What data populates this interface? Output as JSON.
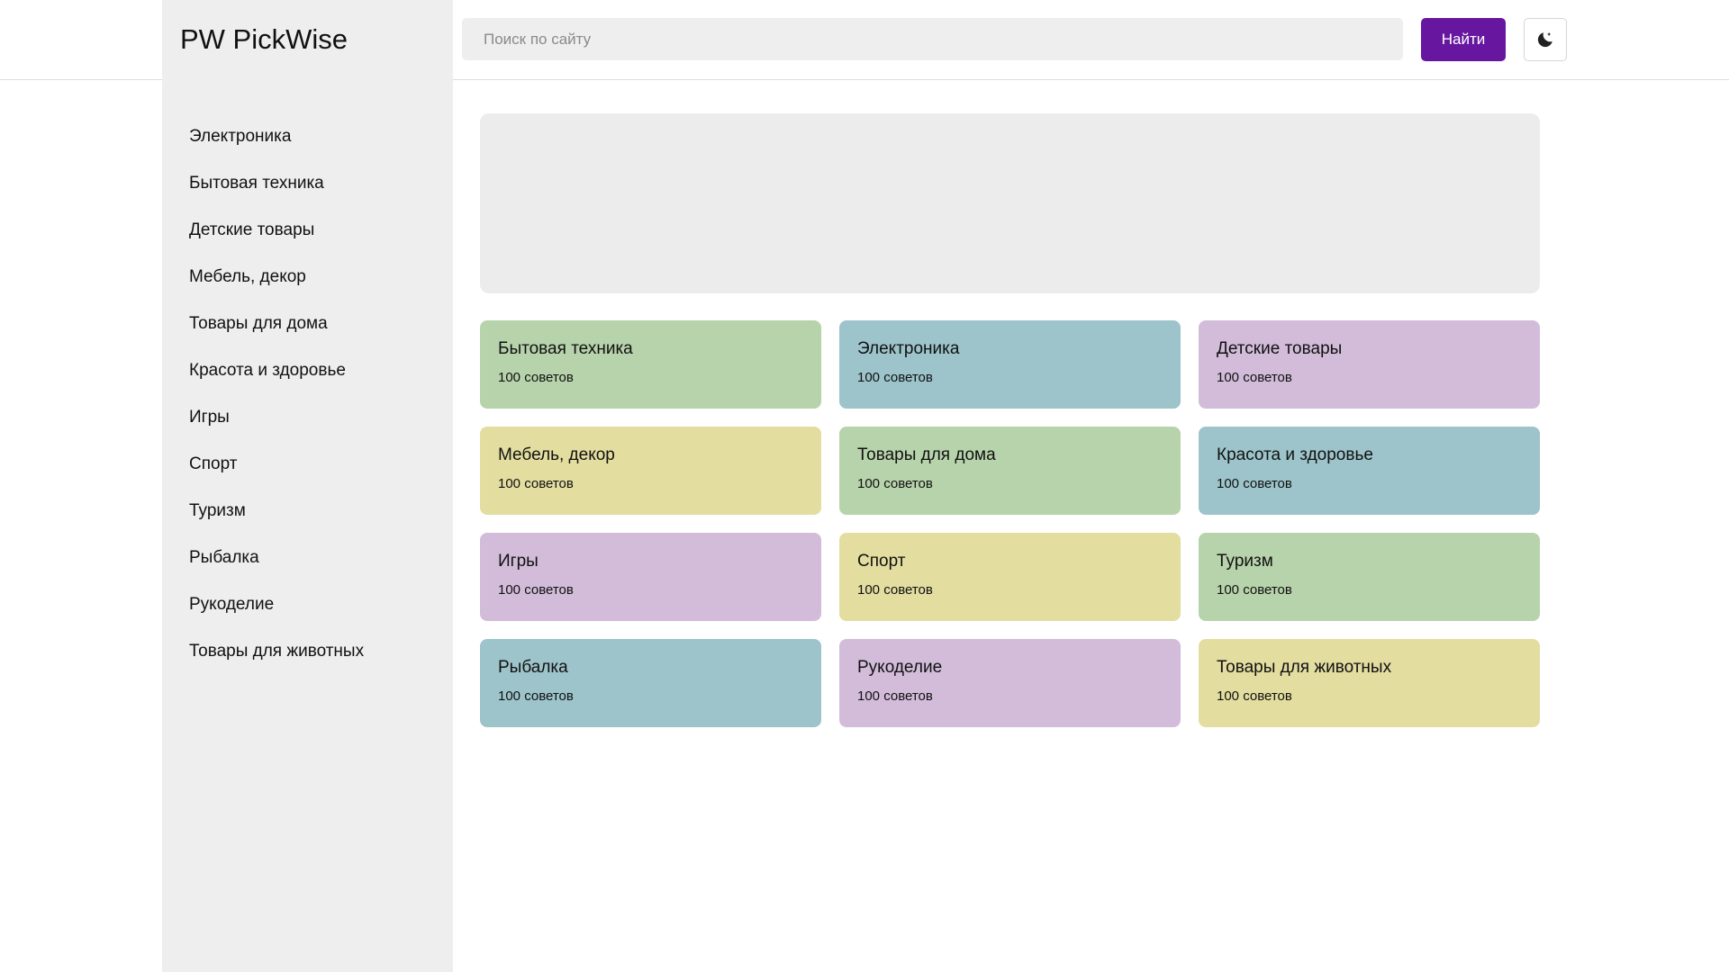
{
  "header": {
    "logo": "PW PickWise",
    "search_placeholder": "Поиск по сайту",
    "search_value": "",
    "search_button": "Найти",
    "theme_toggle_icon": "moon-icon"
  },
  "sidebar": {
    "items": [
      {
        "label": "Электроника"
      },
      {
        "label": "Бытовая техника"
      },
      {
        "label": "Детские товары"
      },
      {
        "label": "Мебель, декор"
      },
      {
        "label": "Товары для дома"
      },
      {
        "label": "Красота и здоровье"
      },
      {
        "label": "Игры"
      },
      {
        "label": "Спорт"
      },
      {
        "label": "Туризм"
      },
      {
        "label": "Рыбалка"
      },
      {
        "label": "Рукоделие"
      },
      {
        "label": "Товары для животных"
      }
    ]
  },
  "colors": {
    "accent": "#67179f",
    "green": "#b7d3ab",
    "blue": "#9cc4ca",
    "purple": "#d2bcd9",
    "yellow": "#e3dda0"
  },
  "categories": [
    {
      "title": "Бытовая техника",
      "count": "100 советов",
      "color": "#b7d3ab"
    },
    {
      "title": "Электроника",
      "count": "100 советов",
      "color": "#9cc4ca"
    },
    {
      "title": "Детские товары",
      "count": "100 советов",
      "color": "#d2bcd9"
    },
    {
      "title": "Мебель, декор",
      "count": "100 советов",
      "color": "#e3dda0"
    },
    {
      "title": "Товары для дома",
      "count": "100 советов",
      "color": "#b7d3ab"
    },
    {
      "title": "Красота и здоровье",
      "count": "100 советов",
      "color": "#9cc4ca"
    },
    {
      "title": "Игры",
      "count": "100 советов",
      "color": "#d2bcd9"
    },
    {
      "title": "Спорт",
      "count": "100 советов",
      "color": "#e3dda0"
    },
    {
      "title": "Туризм",
      "count": "100 советов",
      "color": "#b7d3ab"
    },
    {
      "title": "Рыбалка",
      "count": "100 советов",
      "color": "#9cc4ca"
    },
    {
      "title": "Рукоделие",
      "count": "100 советов",
      "color": "#d2bcd9"
    },
    {
      "title": "Товары для животных",
      "count": "100 советов",
      "color": "#e3dda0"
    }
  ]
}
